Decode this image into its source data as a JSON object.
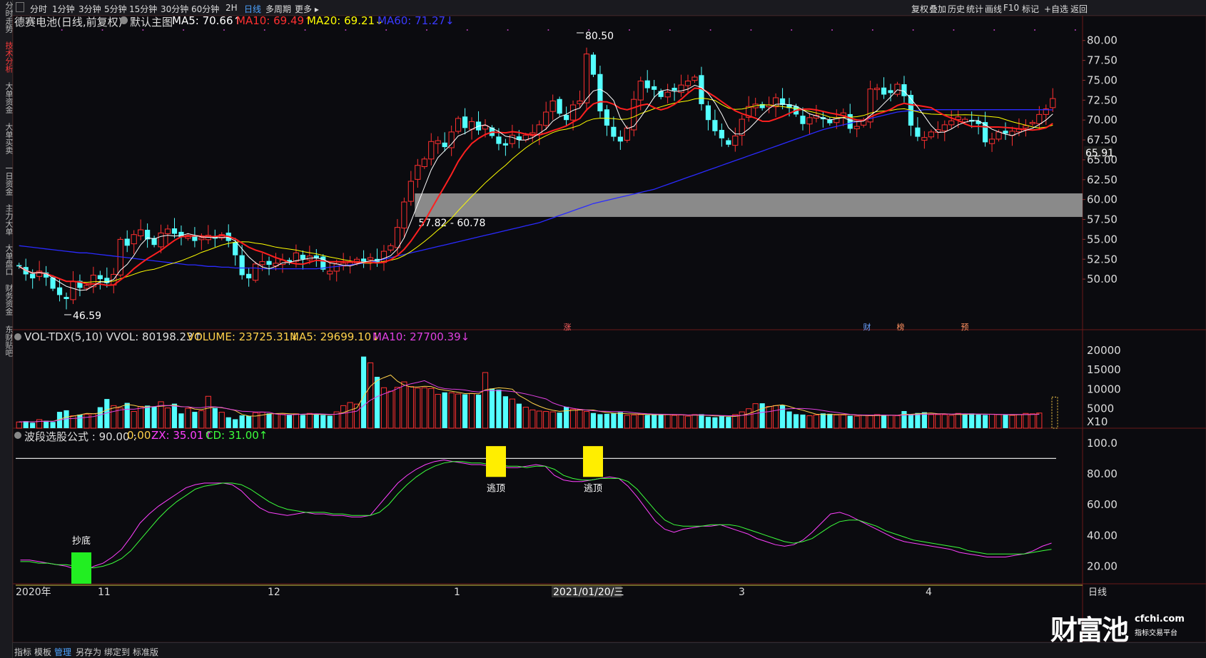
{
  "left_tabs": [
    {
      "label": "分时走势",
      "active": false
    },
    {
      "label": "技术分析",
      "active": true
    },
    {
      "label": "大单资金",
      "active": false
    },
    {
      "label": "大单买卖",
      "active": false
    },
    {
      "label": "一日资金",
      "active": false
    },
    {
      "label": "主力大单",
      "active": false
    },
    {
      "label": "大单盘口",
      "active": false
    },
    {
      "label": "财务资金",
      "active": false
    },
    {
      "label": "东财贴吧",
      "active": false
    }
  ],
  "toolbar": {
    "periods": [
      "分时",
      "1分钟",
      "3分钟",
      "5分钟",
      "15分钟",
      "30分钟",
      "60分钟",
      "2H",
      "日线",
      "多周期",
      "更多"
    ],
    "active_period": "日线",
    "right_items": [
      "复权",
      "叠加",
      "历史",
      "统计",
      "画线",
      "F10",
      "标记",
      "+自选",
      "返回"
    ]
  },
  "main_panel": {
    "title": "德赛电池(日线,前复权)",
    "template": "默认主图",
    "ma5": "MA5: 70.66↑",
    "ma10": "MA10: 69.49↑",
    "ma20": "MA20: 69.21↓",
    "ma60": "MA60: 71.27↓",
    "high_label": "80.50",
    "low_label": "46.59",
    "zone_label": "57.82 - 60.78",
    "last_price": "65.91",
    "y_ticks": [
      "80.00",
      "77.50",
      "75.00",
      "72.50",
      "70.00",
      "67.50",
      "65.00",
      "62.50",
      "60.00",
      "57.50",
      "55.00",
      "52.50",
      "50.00"
    ],
    "markers": [
      {
        "text": "涨"
      },
      {
        "text": "财"
      },
      {
        "text": "榜"
      },
      {
        "text": "预"
      }
    ]
  },
  "volume_panel": {
    "title": "VOL-TDX(5,10) VVOL: 80198.23↑",
    "volume": "VOLUME: 23725.31↓",
    "ma5": "MA5: 29699.10↓",
    "ma10": "MA10: 27700.39↓",
    "y_ticks": [
      "20000",
      "15000",
      "10000",
      "5000"
    ],
    "unit": "X10"
  },
  "indicator_panel": {
    "title": "波段选股公式 : 90.00 :",
    "val": "0.00",
    "zx": "ZX: 35.01↑",
    "cd": "CD: 31.00↑",
    "y_ticks": [
      "100.0",
      "80.00",
      "60.00",
      "40.00",
      "20.00"
    ],
    "labels": {
      "buy": "抄底",
      "sell1": "逃顶",
      "sell2": "逃顶"
    }
  },
  "x_axis": {
    "labels": [
      "2020年",
      "11",
      "12",
      "1",
      "2021/01/20/三",
      "3",
      "4"
    ],
    "corner": "日线"
  },
  "bottom_tabs": [
    "指标",
    "模板",
    "管理",
    "另存为",
    "绑定到",
    "标准版"
  ],
  "bottom_active": "管理",
  "watermark": {
    "brand": "财富池",
    "site": "cfchi.com",
    "slogan": "指标交易平台"
  },
  "colors": {
    "up": "#ff3030",
    "down": "#54ffff",
    "ma5": "#ffffff",
    "ma10": "#ff2020",
    "ma20": "#ffff00",
    "ma60": "#2a2aff",
    "zx": "#ff40ff",
    "cd": "#3cff3c"
  },
  "chart_data": [
    {
      "type": "candlestick",
      "title": "德赛电池(日线,前复权)",
      "ylim": [
        44,
        81.5
      ],
      "y_ticks": [
        80,
        77.5,
        75,
        72.5,
        70,
        67.5,
        65,
        62.5,
        60,
        57.5,
        55,
        52.5,
        50
      ],
      "annotations": [
        {
          "label": "80.50",
          "value": 80.5
        },
        {
          "label": "46.59",
          "value": 46.59
        },
        {
          "label": "57.82 - 60.78",
          "range": [
            57.82,
            60.78
          ]
        }
      ],
      "close": [
        51.6,
        50.6,
        50.1,
        51.0,
        50.2,
        48.8,
        48.0,
        47.5,
        49.7,
        48.9,
        49.2,
        50.5,
        50.0,
        49.5,
        50.6,
        55.0,
        54.2,
        55.6,
        56.2,
        55.0,
        54.3,
        55.8,
        56.3,
        55.7,
        55.3,
        55.5,
        54.8,
        55.2,
        55.5,
        55.1,
        55.6,
        54.8,
        53.0,
        50.5,
        50.1,
        51.9,
        52.2,
        51.8,
        52.0,
        52.4,
        52.1,
        53.3,
        52.5,
        52.9,
        52.6,
        51.2,
        51.0,
        51.9,
        52.0,
        52.1,
        52.5,
        52.2,
        52.7,
        52.1,
        53.5,
        54.2,
        56.5,
        59.7,
        62.3,
        64.3,
        65.1,
        67.3,
        67.4,
        66.6,
        68.5,
        70.2,
        69.0,
        69.8,
        68.7,
        69.3,
        68.0,
        67.0,
        66.8,
        68.1,
        67.5,
        68.1,
        68.4,
        69.4,
        71.0,
        72.4,
        70.8,
        70.0,
        71.9,
        72.4,
        78.3,
        75.7,
        71.1,
        69.3,
        67.9,
        67.3,
        69.0,
        72.6,
        74.9,
        74.0,
        73.8,
        72.9,
        73.5,
        73.7,
        74.4,
        74.9,
        75.4,
        72.0,
        70.0,
        68.6,
        67.7,
        66.9,
        68.0,
        70.1,
        71.7,
        72.0,
        71.5,
        71.9,
        72.8,
        71.9,
        71.5,
        70.7,
        69.5,
        70.3,
        70.6,
        70.1,
        69.6,
        70.3,
        70.9,
        68.9,
        69.2,
        70.0,
        73.9,
        74.0,
        73.2,
        73.4,
        74.5,
        73.0,
        69.3,
        67.9,
        67.8,
        68.5,
        68.8,
        69.4,
        69.9,
        70.4,
        70.1,
        69.8,
        69.5,
        67.2,
        67.6,
        68.5,
        68.3,
        68.6,
        68.9,
        69.3,
        69.7,
        70.7,
        71.4,
        72.7
      ],
      "ma60": [
        54.2,
        54.1,
        54.0,
        53.9,
        53.8,
        53.7,
        53.6,
        53.5,
        53.4,
        53.3,
        53.3,
        53.2,
        53.1,
        53.0,
        52.9,
        52.8,
        52.7,
        52.6,
        52.5,
        52.4,
        52.3,
        52.2,
        52.1,
        52.0,
        51.9,
        51.8,
        51.8,
        51.7,
        51.6,
        51.6,
        51.5,
        51.5,
        51.4,
        51.4,
        51.4,
        51.4,
        51.3,
        51.3,
        51.3,
        51.3,
        51.3,
        51.3,
        51.3,
        51.3,
        51.3,
        51.4,
        51.5,
        51.6,
        51.7,
        51.8,
        51.9,
        52.0,
        52.1,
        52.3,
        52.5,
        52.7,
        52.9,
        53.1,
        53.3,
        53.5,
        53.7,
        53.9,
        54.1,
        54.3,
        54.5,
        54.7,
        54.9,
        55.1,
        55.3,
        55.5,
        55.7,
        55.9,
        56.1,
        56.3,
        56.5,
        56.7,
        56.9,
        57.1,
        57.4,
        57.7,
        58.0,
        58.3,
        58.6,
        58.9,
        59.2,
        59.5,
        59.7,
        59.9,
        60.1,
        60.3,
        60.5,
        60.7,
        60.9,
        61.1,
        61.3,
        61.6,
        61.9,
        62.2,
        62.5,
        62.8,
        63.1,
        63.4,
        63.7,
        64.0,
        64.3,
        64.6,
        64.9,
        65.2,
        65.5,
        65.8,
        66.1,
        66.4,
        66.7,
        67.0,
        67.3,
        67.6,
        67.9,
        68.2,
        68.5,
        68.8,
        69.0,
        69.2,
        69.4,
        69.6,
        69.8,
        70.0,
        70.2,
        70.4,
        70.6,
        70.8,
        71.0,
        71.1,
        71.2,
        71.2,
        71.3,
        71.3,
        71.3,
        71.3,
        71.3,
        71.3,
        71.3,
        71.3,
        71.3,
        71.3,
        71.3,
        71.3,
        71.3,
        71.3,
        71.3,
        71.3,
        71.3,
        71.3,
        71.3,
        71.27
      ]
    },
    {
      "type": "bar",
      "title": "VOL-TDX(5,10)",
      "ylim": [
        0,
        22000
      ],
      "values": [
        1600,
        1800,
        1400,
        2200,
        1900,
        1600,
        4200,
        4600,
        3200,
        3500,
        3600,
        3700,
        5400,
        7500,
        5800,
        5200,
        6500,
        4300,
        5600,
        5800,
        5600,
        6800,
        5200,
        6300,
        3800,
        5100,
        4200,
        4500,
        8200,
        5200,
        4100,
        2800,
        2300,
        3300,
        3200,
        4000,
        4100,
        3800,
        3700,
        3600,
        3400,
        3700,
        3400,
        3800,
        3500,
        3400,
        3200,
        4200,
        5800,
        6600,
        6200,
        18400,
        16800,
        13200,
        10400,
        9500,
        10500,
        11900,
        10700,
        10300,
        10400,
        10200,
        8700,
        9200,
        9100,
        8800,
        8700,
        8900,
        8600,
        14300,
        10200,
        9900,
        8200,
        7500,
        6300,
        5400,
        4700,
        4400,
        4300,
        4200,
        4000,
        5500,
        4900,
        4800,
        4300,
        3900,
        3600,
        3700,
        3800,
        4100,
        3300,
        3400,
        3500,
        3400,
        3600,
        3500,
        3500,
        3300,
        3400,
        3100,
        3500,
        3600,
        2900,
        2800,
        3100,
        2900,
        3500,
        4200,
        5000,
        6300,
        6400,
        5600,
        5800,
        5900,
        4300,
        3600,
        3500,
        3200,
        3400,
        3800,
        3700,
        3400,
        3400,
        3200,
        3100,
        3300,
        3200,
        3500,
        3400,
        3300,
        3200,
        4400,
        3600,
        3900,
        4100,
        3500,
        3500,
        3500,
        3300,
        3800,
        3600,
        3800,
        3500,
        3400,
        3600,
        3500,
        3400,
        3300,
        3500,
        3800,
        3700,
        3900
      ],
      "last_volume": 23725.31
    },
    {
      "type": "line",
      "title": "波段选股公式",
      "ylim": [
        0,
        105
      ],
      "series": [
        {
          "name": "ZX",
          "values": [
            24,
            24,
            23,
            22,
            21,
            20,
            18,
            17,
            20,
            22,
            26,
            31,
            39,
            48,
            54,
            59,
            63,
            67,
            71,
            73,
            74,
            74,
            74,
            73,
            69,
            63,
            58,
            55,
            54,
            53,
            54,
            55,
            54,
            54,
            53,
            53,
            52,
            52,
            53,
            60,
            67,
            74,
            79,
            83,
            86,
            88,
            89,
            88,
            87,
            86,
            86,
            85,
            85,
            84,
            84,
            85,
            86,
            85,
            79,
            76,
            75,
            75,
            76,
            77,
            78,
            77,
            72,
            65,
            57,
            49,
            44,
            42,
            44,
            45,
            46,
            46,
            47,
            45,
            43,
            41,
            38,
            36,
            34,
            33,
            34,
            37,
            42,
            48,
            54,
            55,
            53,
            50,
            47,
            44,
            41,
            38,
            36,
            35,
            34,
            33,
            32,
            31,
            29,
            28,
            27,
            26,
            26,
            26,
            27,
            28,
            30,
            33,
            35.01
          ]
        },
        {
          "name": "CD",
          "values": [
            23,
            23,
            22,
            22,
            21,
            21,
            20,
            19,
            19,
            20,
            22,
            25,
            30,
            37,
            44,
            51,
            57,
            62,
            66,
            70,
            72,
            73,
            74,
            74,
            73,
            70,
            66,
            62,
            59,
            57,
            56,
            55,
            55,
            55,
            54,
            54,
            53,
            53,
            53,
            55,
            60,
            67,
            73,
            78,
            82,
            85,
            87,
            88,
            88,
            87,
            87,
            86,
            86,
            85,
            85,
            84,
            85,
            85,
            83,
            79,
            77,
            76,
            76,
            77,
            77,
            77,
            75,
            70,
            63,
            56,
            50,
            47,
            46,
            46,
            46,
            47,
            47,
            47,
            46,
            44,
            42,
            40,
            38,
            36,
            35,
            36,
            38,
            42,
            46,
            49,
            50,
            50,
            48,
            46,
            43,
            41,
            39,
            37,
            36,
            35,
            34,
            33,
            32,
            30,
            29,
            28,
            28,
            28,
            28,
            28,
            29,
            30,
            31.0
          ]
        }
      ],
      "reference_line": 90.0,
      "signals": [
        {
          "label": "抄底"
        },
        {
          "label": "逃顶"
        },
        {
          "label": "逃顶"
        }
      ]
    }
  ]
}
